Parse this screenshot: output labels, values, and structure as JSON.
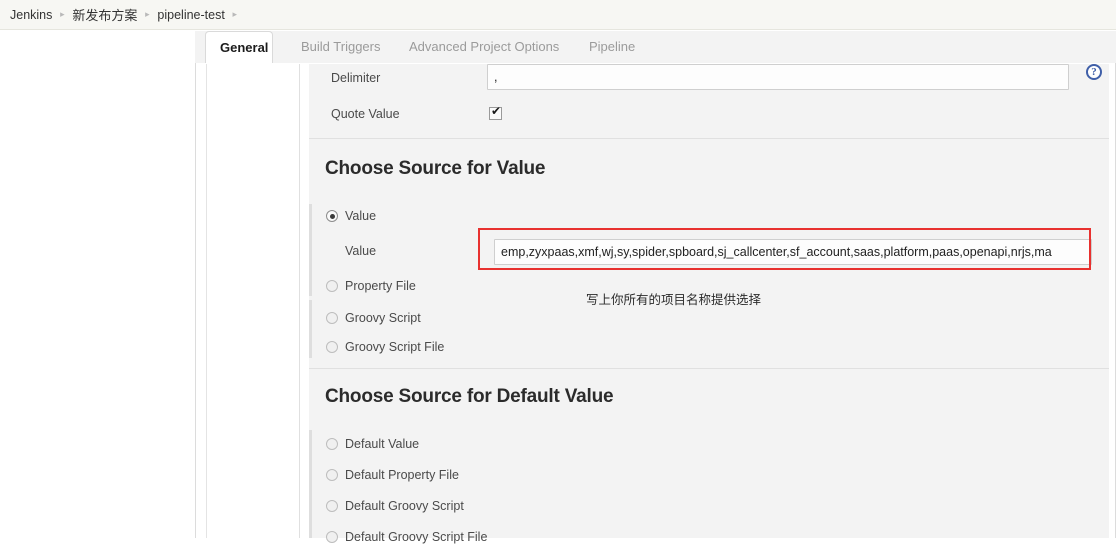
{
  "breadcrumb": {
    "items": [
      "Jenkins",
      "新发布方案",
      "pipeline-test"
    ],
    "separator": "▸",
    "trailing_separator": "▸"
  },
  "tabs": [
    {
      "label": "General",
      "active": true
    },
    {
      "label": "Build Triggers",
      "active": false
    },
    {
      "label": "Advanced Project Options",
      "active": false
    },
    {
      "label": "Pipeline",
      "active": false
    }
  ],
  "form": {
    "delimiter": {
      "label": "Delimiter",
      "value": ","
    },
    "quote_value": {
      "label": "Quote Value",
      "checked": true,
      "tick": "✔"
    },
    "help_icon": "?"
  },
  "value_section": {
    "heading": "Choose Source for Value",
    "options": [
      {
        "label": "Value",
        "checked": true
      },
      {
        "label": "Property File",
        "checked": false
      },
      {
        "label": "Groovy Script",
        "checked": false
      },
      {
        "label": "Groovy Script File",
        "checked": false
      }
    ],
    "value_field": {
      "label": "Value",
      "value": "emp,zyxpaas,xmf,wj,sy,spider,spboard,sj_callcenter,sf_account,saas,platform,paas,openapi,nrjs,ma"
    },
    "annotation": "写上你所有的项目名称提供选择",
    "highlight_color": "#e8312f"
  },
  "default_value_section": {
    "heading": "Choose Source for Default Value",
    "options": [
      {
        "label": "Default Value",
        "checked": false
      },
      {
        "label": "Default Property File",
        "checked": false
      },
      {
        "label": "Default Groovy Script",
        "checked": false
      },
      {
        "label": "Default Groovy Script File",
        "checked": false
      }
    ]
  }
}
